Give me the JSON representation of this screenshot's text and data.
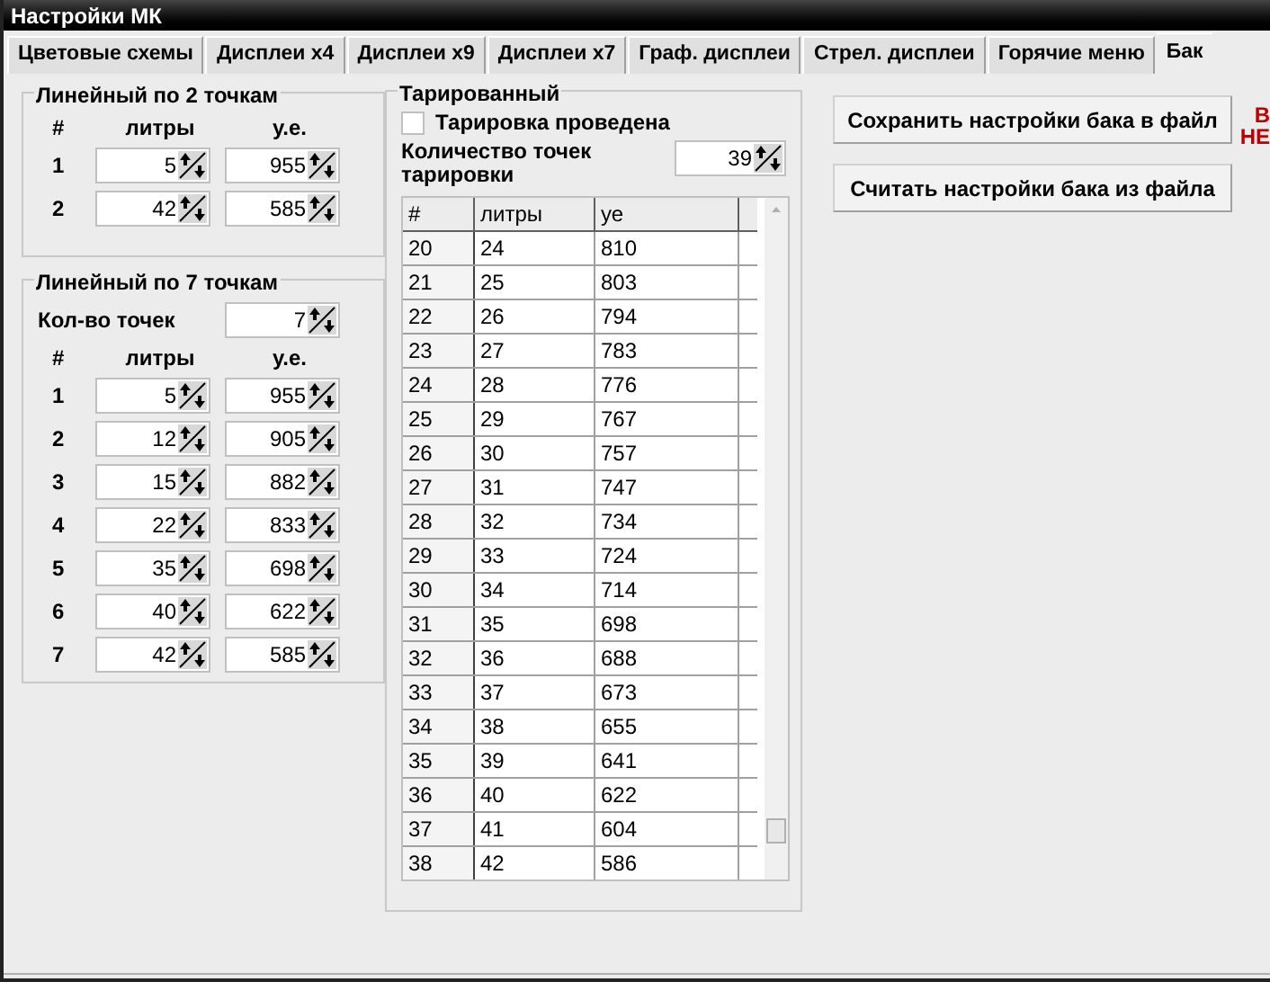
{
  "window": {
    "title": "Настройки МК"
  },
  "tabs": [
    {
      "label": "Цветовые схемы",
      "selected": false
    },
    {
      "label": "Дисплеи x4",
      "selected": false
    },
    {
      "label": "Дисплеи x9",
      "selected": false
    },
    {
      "label": "Дисплеи x7",
      "selected": false
    },
    {
      "label": "Граф. дисплеи",
      "selected": false
    },
    {
      "label": "Стрел. дисплеи",
      "selected": false
    },
    {
      "label": "Горячие меню",
      "selected": false
    },
    {
      "label": "Бак",
      "selected": true
    }
  ],
  "linear2": {
    "title": "Линейный по 2 точкам",
    "columns": [
      "#",
      "литры",
      "у.е."
    ],
    "rows": [
      {
        "n": "1",
        "liters": "5",
        "units": "955"
      },
      {
        "n": "2",
        "liters": "42",
        "units": "585"
      }
    ]
  },
  "linear7": {
    "title": "Линейный по 7 точкам",
    "count_label": "Кол-во точек",
    "count": "7",
    "columns": [
      "#",
      "литры",
      "у.е."
    ],
    "rows": [
      {
        "n": "1",
        "liters": "5",
        "units": "955"
      },
      {
        "n": "2",
        "liters": "12",
        "units": "905"
      },
      {
        "n": "3",
        "liters": "15",
        "units": "882"
      },
      {
        "n": "4",
        "liters": "22",
        "units": "833"
      },
      {
        "n": "5",
        "liters": "35",
        "units": "698"
      },
      {
        "n": "6",
        "liters": "40",
        "units": "622"
      },
      {
        "n": "7",
        "liters": "42",
        "units": "585"
      }
    ]
  },
  "calibrated": {
    "title": "Тарированный",
    "checkbox": {
      "label": "Тарировка проведена",
      "checked": false
    },
    "count_label": "Количество точек тарировки",
    "count": "39",
    "table": {
      "columns": [
        "#",
        "литры",
        "уе"
      ],
      "rows": [
        [
          "20",
          "24",
          "810"
        ],
        [
          "21",
          "25",
          "803"
        ],
        [
          "22",
          "26",
          "794"
        ],
        [
          "23",
          "27",
          "783"
        ],
        [
          "24",
          "28",
          "776"
        ],
        [
          "25",
          "29",
          "767"
        ],
        [
          "26",
          "30",
          "757"
        ],
        [
          "27",
          "31",
          "747"
        ],
        [
          "28",
          "32",
          "734"
        ],
        [
          "29",
          "33",
          "724"
        ],
        [
          "30",
          "34",
          "714"
        ],
        [
          "31",
          "35",
          "698"
        ],
        [
          "32",
          "36",
          "688"
        ],
        [
          "33",
          "37",
          "673"
        ],
        [
          "34",
          "38",
          "655"
        ],
        [
          "35",
          "39",
          "641"
        ],
        [
          "36",
          "40",
          "622"
        ],
        [
          "37",
          "41",
          "604"
        ],
        [
          "38",
          "42",
          "586"
        ]
      ]
    }
  },
  "buttons": [
    "Сохранить настройки бака в файл",
    "Считать настройки бака из файла"
  ],
  "warning": [
    "В",
    "НЕ"
  ]
}
